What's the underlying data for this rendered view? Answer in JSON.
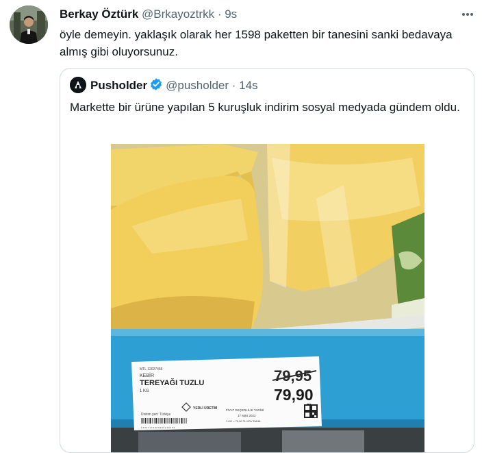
{
  "tweet": {
    "author_name": "Berkay Öztürk",
    "handle": "@Brkayoztrkk",
    "separator": "·",
    "time": "9s",
    "text": "öyle demeyin. yaklaşık olarak her 1598 paketten bir tanesini sanki bedavaya almış gibi oluyorsunuz."
  },
  "quoted_tweet": {
    "author_name": "Pusholder",
    "handle": "@pusholder",
    "separator": "·",
    "time": "14s",
    "text": "Markette bir ürüne yapılan 5 kuruşluk indirim sosyal medyada gündem oldu.",
    "photo": {
      "label": {
        "small_code": "MTL 12027466",
        "brand": "KEBİR",
        "product": "TEREYAĞI TUZLU",
        "weight": "1 KG",
        "old_price": "79,95",
        "new_price": "79,90",
        "currency": "TL",
        "origin": "Üretim yeri: Türkiye",
        "badge": "YERLİ ÜRETİM",
        "validity_title": "FİYAT GEÇERLİLİK TARİHİ",
        "validity_date": "17 Mart 2022",
        "unit_price": "1 KG = 79,90 TL KDV DAHİL",
        "barcode_digits": "1 2 0 2 7 1 1 5 8 0 0 2 9 6 1 7 0 2 5 3"
      }
    }
  },
  "colors": {
    "name": "#0f1419",
    "secondary": "#536471",
    "border": "#cfd9de",
    "verified": "#1d9bf0",
    "shelf": "#2e9fd2"
  },
  "icons": [
    "more-icon",
    "verified-badge-icon",
    "pusholder-logo-icon",
    "barcode",
    "qr-code"
  ]
}
